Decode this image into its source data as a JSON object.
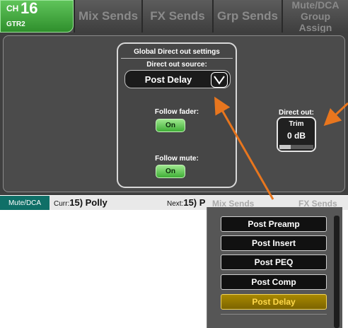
{
  "channel": {
    "prefix": "CH",
    "number": "16",
    "name": "GTR2"
  },
  "tabs": [
    {
      "label": "Mix Sends"
    },
    {
      "label": "FX Sends"
    },
    {
      "label": "Grp Sends"
    },
    {
      "label_line1": "Mute/DCA",
      "label_line2": "Group Assign"
    }
  ],
  "global_direct": {
    "title": "Global Direct out settings",
    "source_label": "Direct out source:",
    "source_value": "Post Delay",
    "follow_fader_label": "Follow fader:",
    "follow_fader_value": "On",
    "follow_mute_label": "Follow mute:",
    "follow_mute_value": "On"
  },
  "direct_out": {
    "label": "Direct out:",
    "trim_label": "Trim",
    "trim_value": "0 dB"
  },
  "status_bar": {
    "mode": "Mute/DCA",
    "curr_prefix": "Curr:",
    "curr_value": "15) Polly",
    "next_prefix": "Next:",
    "next_value": "15) P",
    "faded_tab1": "Mix Sends",
    "faded_tab2": "FX Sends"
  },
  "source_options": [
    {
      "label": "Post Preamp",
      "selected": false
    },
    {
      "label": "Post Insert",
      "selected": false
    },
    {
      "label": "Post PEQ",
      "selected": false
    },
    {
      "label": "Post Comp",
      "selected": false
    },
    {
      "label": "Post Delay",
      "selected": true
    }
  ],
  "colors": {
    "accent_green": "#3fae36",
    "selected_option": "#ffd84a",
    "annotation_arrow": "#e8761e"
  }
}
